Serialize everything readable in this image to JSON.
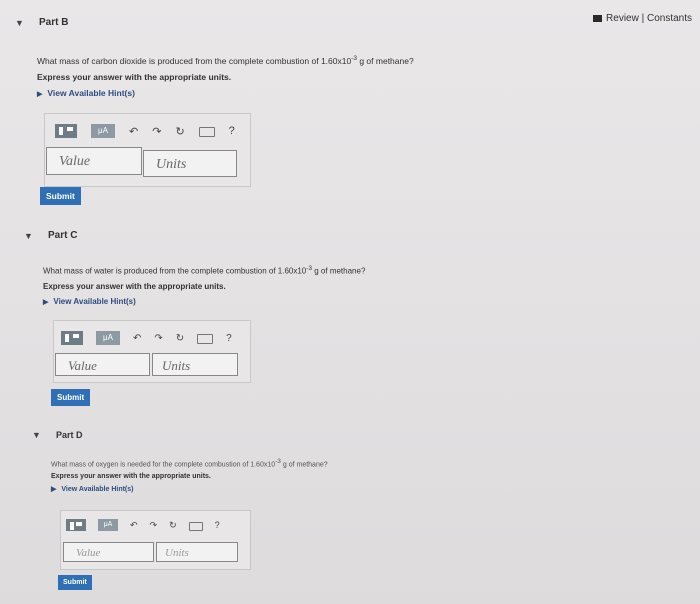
{
  "header": {
    "review_constants": "Review | Constants"
  },
  "parts": [
    {
      "label": "Part B",
      "question_prefix": "What mass of carbon dioxide is produced from the complete combustion of 1.60x10",
      "exponent": "-3",
      "question_suffix": " g of methane?",
      "instruction": "Express your answer with the appropriate units.",
      "hints": "View Available Hint(s)",
      "value_placeholder": "Value",
      "units_placeholder": "Units",
      "submit_label": "Submit"
    },
    {
      "label": "Part C",
      "question_prefix": "What mass of water is produced from the complete combustion of 1.60x10",
      "exponent": "-3",
      "question_suffix": " g of methane?",
      "instruction": "Express your answer with the appropriate units.",
      "hints": "View Available Hint(s)",
      "value_placeholder": "Value",
      "units_placeholder": "Units",
      "submit_label": "Submit"
    },
    {
      "label": "Part D",
      "question_prefix": "What mass of oxygen is needed for the complete combustion of 1.60x10",
      "exponent": "-3",
      "question_suffix": " g of methane?",
      "instruction": "Express your answer with the appropriate units.",
      "hints": "View Available Hint(s)",
      "value_placeholder": "Value",
      "units_placeholder": "Units",
      "submit_label": "Submit"
    }
  ],
  "toolbar": {
    "mu_label": "μA",
    "help_label": "?"
  },
  "colors": {
    "submit": "#2f6fb5",
    "hint_link": "#2c4d82"
  }
}
